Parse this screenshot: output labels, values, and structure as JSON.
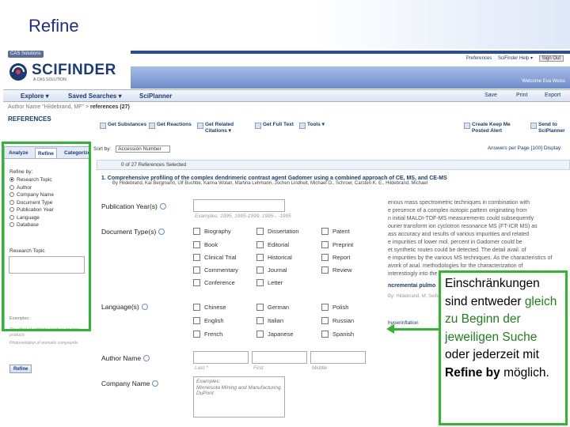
{
  "slide": {
    "title": "Refine"
  },
  "header": {
    "cas_solutions": "CAS Solutions",
    "logo_word": "SCIFINDER",
    "logo_sub": "A CAS SOLUTION",
    "links": [
      "Preferences",
      "SciFinder Help ▾",
      "Sign Out"
    ],
    "welcome": "Welcome Eva Weiss"
  },
  "nav": {
    "items": [
      "Explore ▾",
      "Saved Searches ▾",
      "SciPlanner"
    ],
    "right": [
      "Save",
      "Print",
      "Export"
    ]
  },
  "breadcrumb": {
    "prefix": "Author Name \"Hildebrand, MF\" > ",
    "current": "references (27)"
  },
  "refs_heading": "REFERENCES",
  "toolbar": [
    {
      "label": "Get Substances"
    },
    {
      "label": "Get Reactions"
    },
    {
      "label": "Get Related Citations ▾"
    },
    {
      "label": "Get Full Text"
    },
    {
      "label": "Tools ▾"
    },
    {
      "label": "Create Keep Me Posted Alert"
    },
    {
      "label": "Send to SciPlanner"
    }
  ],
  "panel": {
    "tabs": [
      "Analyze",
      "Refine",
      "Categorize"
    ],
    "refine_by": "Refine by:",
    "options": [
      "Research Topic",
      "Author",
      "Company Name",
      "Document Type",
      "Publication Year",
      "Language",
      "Database"
    ],
    "section_label": "Research Topic",
    "examples_label": "Examples:",
    "example_1": "The effect of antibiotic residues on dairy products",
    "example_2": "Photooxidation of aromatic compounds",
    "refine_button": "Refine"
  },
  "sortbar": {
    "sort_by": "Sort by:",
    "sort_value": "Accession Number",
    "right": "Answers per Page [100]  Display:"
  },
  "listbar": "0 of 27 References Selected",
  "result": {
    "title": "1.  Comprehensive profiling of the complex dendrimeric contrast agent Gadomer using a combined approach of CE, MS, and CE-MS",
    "authors": "By Hildebrand, Kai Bergmann, Ulf Buchbe, Karina Wotan, Martina Lehmann, Jochen Lindheit, Michael O., Schroer, Carsten K. E., Hildebrand, Michael"
  },
  "background_text": [
    "enous mass spectrometric techniques in combination with",
    "e presence of a complex isotopic pattern originating from",
    "n initial MALDI-TOF-MS measurements could subsequently",
    "ourier transform ion cyclotron resonance MS (FT-ICR MS) as",
    "ass accuracy and results of various impurities and related",
    "e impurities of lower mol. percent in Gadomer could be",
    "et synthetic routes could be detected. The detail avail. of",
    "e impurities by the various MS techniques. As the characteristics of",
    "avork of anal. methodologies for the characterization of",
    "interestingly into the lab, since many compounds are"
  ],
  "background_links": {
    "journal": "ncrementai pulmo",
    "authors": "By: Hildebrand, M; Seifert",
    "hyper": "hyperinflation"
  },
  "form": {
    "pub_year_label": "Publication Year(s)",
    "pub_year_hint": "Examples: 1995, 1995-1999, 1995-, -1995",
    "doc_type_label": "Document Type(s)",
    "doc_types": [
      [
        "Biography",
        "Dissertation",
        "Patent"
      ],
      [
        "Book",
        "Editorial",
        "Preprint"
      ],
      [
        "Clinical Trial",
        "Historical",
        "Report"
      ],
      [
        "Commentary",
        "Journal",
        "Review"
      ],
      [
        "Conference",
        "Letter",
        ""
      ]
    ],
    "language_label": "Language(s)",
    "languages": [
      [
        "Chinese",
        "German",
        "Polish"
      ],
      [
        "English",
        "Italian",
        "Russian"
      ],
      [
        "French",
        "Japanese",
        "Spanish"
      ]
    ],
    "author_label": "Author Name",
    "author_hints": [
      "Last *",
      "First",
      "Middle"
    ],
    "company_label": "Company Name",
    "company_hint": "Examples:\nMinnesota Mining and Manufacturing\nDuPont"
  },
  "callout": {
    "part1": "Einschränkungen sind entweder ",
    "part2": "gleich zu Beginn der jeweiligen Suche",
    "part3": " oder jederzeit mit ",
    "part4": "Refine by",
    "part5": " möglich."
  }
}
